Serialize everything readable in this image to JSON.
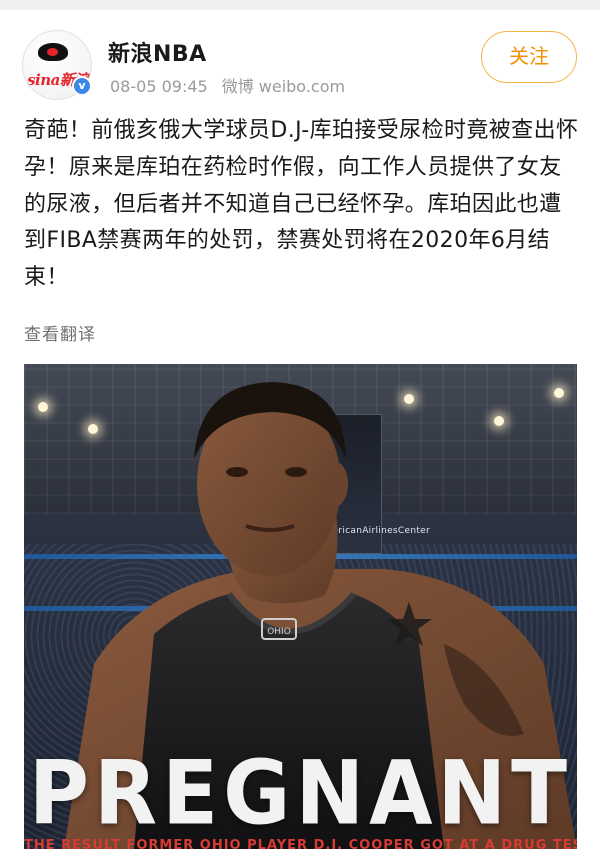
{
  "post": {
    "account_name": "新浪NBA",
    "timestamp": "08-05 09:45",
    "source": "微博 weibo.com",
    "follow_label": "关注",
    "verified_mark": "v",
    "avatar_logo_text": "sina新浪",
    "text": "奇葩！前俄亥俄大学球员D.J-库珀接受尿检时竟被查出怀孕！原来是库珀在药检时作假，向工作人员提供了女友的尿液，但后者并不知道自己已经怀孕。库珀因此也遭到FIBA禁赛两年的处罚，禁赛处罚将在2020年6月结束！",
    "translate_label": "查看翻译"
  },
  "image": {
    "headline": "PREGNANT",
    "subheadline": "THE RESULT FORMER OHIO PLAYER D.J. COOPER GOT AT A DRUG TEST",
    "arena_sign": "AmericanAirlinesCenter",
    "jersey_text": "OHIO",
    "accent_colors": {
      "follow": "#f29100",
      "headline_sub": "#d83a34",
      "verified": "#3d87e6"
    }
  }
}
